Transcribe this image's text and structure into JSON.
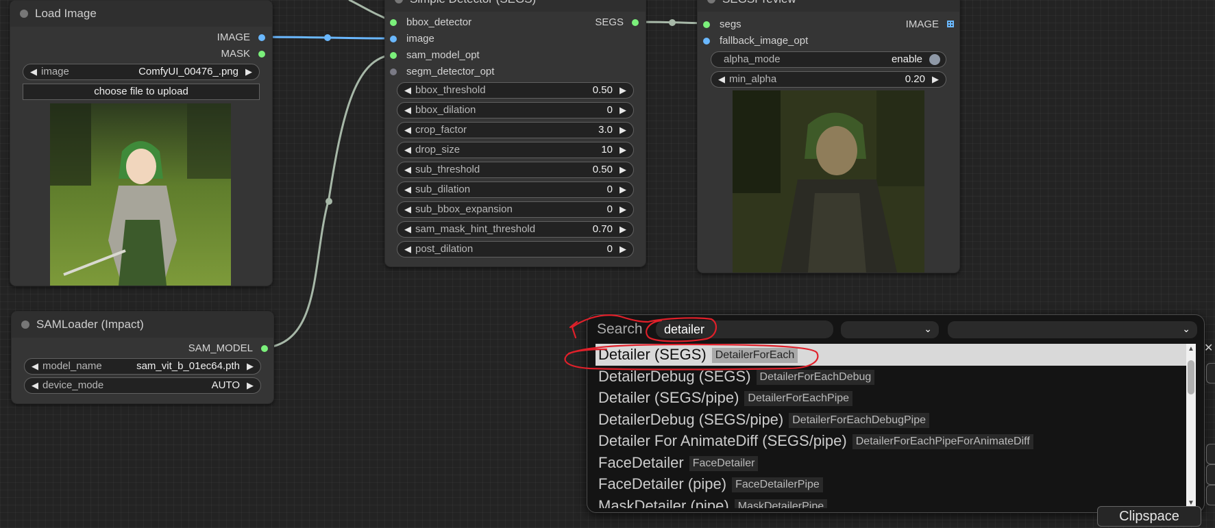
{
  "nodes": {
    "load_image": {
      "title": "Load Image",
      "outputs": [
        "IMAGE",
        "MASK"
      ],
      "image_widget": {
        "label": "image",
        "value": "ComfyUI_00476_.png"
      },
      "upload_label": "choose file to upload"
    },
    "simple_detector": {
      "title": "Simple Detector (SEGS)",
      "inputs": [
        "bbox_detector",
        "image",
        "sam_model_opt",
        "segm_detector_opt"
      ],
      "output": "SEGS",
      "widgets": [
        {
          "label": "bbox_threshold",
          "value": "0.50"
        },
        {
          "label": "bbox_dilation",
          "value": "0"
        },
        {
          "label": "crop_factor",
          "value": "3.0"
        },
        {
          "label": "drop_size",
          "value": "10"
        },
        {
          "label": "sub_threshold",
          "value": "0.50"
        },
        {
          "label": "sub_dilation",
          "value": "0"
        },
        {
          "label": "sub_bbox_expansion",
          "value": "0"
        },
        {
          "label": "sam_mask_hint_threshold",
          "value": "0.70"
        },
        {
          "label": "post_dilation",
          "value": "0"
        }
      ]
    },
    "segs_preview": {
      "title": "SEGSPreview",
      "inputs": [
        "segs",
        "fallback_image_opt"
      ],
      "output": "IMAGE",
      "alpha_mode": {
        "label": "alpha_mode",
        "value": "enable"
      },
      "min_alpha": {
        "label": "min_alpha",
        "value": "0.20"
      }
    },
    "sam_loader": {
      "title": "SAMLoader (Impact)",
      "output": "SAM_MODEL",
      "widgets": [
        {
          "label": "model_name",
          "value": "sam_vit_b_01ec64.pth"
        },
        {
          "label": "device_mode",
          "value": "AUTO"
        }
      ]
    }
  },
  "search": {
    "label": "Search",
    "query": "detailer",
    "results": [
      {
        "name": "Detailer (SEGS)",
        "type": "DetailerForEach",
        "selected": true
      },
      {
        "name": "DetailerDebug (SEGS)",
        "type": "DetailerForEachDebug"
      },
      {
        "name": "Detailer (SEGS/pipe)",
        "type": "DetailerForEachPipe"
      },
      {
        "name": "DetailerDebug (SEGS/pipe)",
        "type": "DetailerForEachDebugPipe"
      },
      {
        "name": "Detailer For AnimateDiff (SEGS/pipe)",
        "type": "DetailerForEachPipeForAnimateDiff"
      },
      {
        "name": "FaceDetailer",
        "type": "FaceDetailer"
      },
      {
        "name": "FaceDetailer (pipe)",
        "type": "FaceDetailerPipe"
      },
      {
        "name": "MaskDetailer (pipe)",
        "type": "MaskDetailerPipe"
      }
    ]
  },
  "clipspace_label": "Clipspace",
  "colors": {
    "image_link": "#6ab8ff",
    "link_gray": "#a7b8a8",
    "annotation": "#e0202a"
  }
}
